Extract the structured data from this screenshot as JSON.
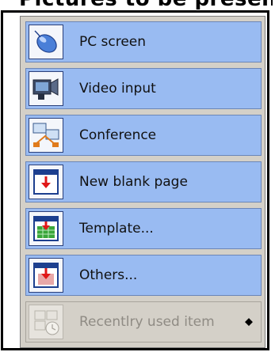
{
  "top_text": "Pictures to be presented",
  "menu": {
    "items": [
      {
        "label": "PC screen",
        "icon": "mouse-icon",
        "enabled": true
      },
      {
        "label": "Video input",
        "icon": "video-camera-icon",
        "enabled": true
      },
      {
        "label": "Conference",
        "icon": "conference-icon",
        "enabled": true
      },
      {
        "label": "New blank page",
        "icon": "new-page-icon",
        "enabled": true
      },
      {
        "label": "Template...",
        "icon": "template-icon",
        "enabled": true
      },
      {
        "label": "Others...",
        "icon": "others-icon",
        "enabled": true
      },
      {
        "label": "Recentlry used item",
        "icon": "recent-items-icon",
        "enabled": false,
        "submenu_glyph": "◆"
      }
    ]
  },
  "colors": {
    "item_background": "#99bbf2",
    "disabled_background": "#d4d0c8",
    "panel_background": "#d4d0c8"
  }
}
